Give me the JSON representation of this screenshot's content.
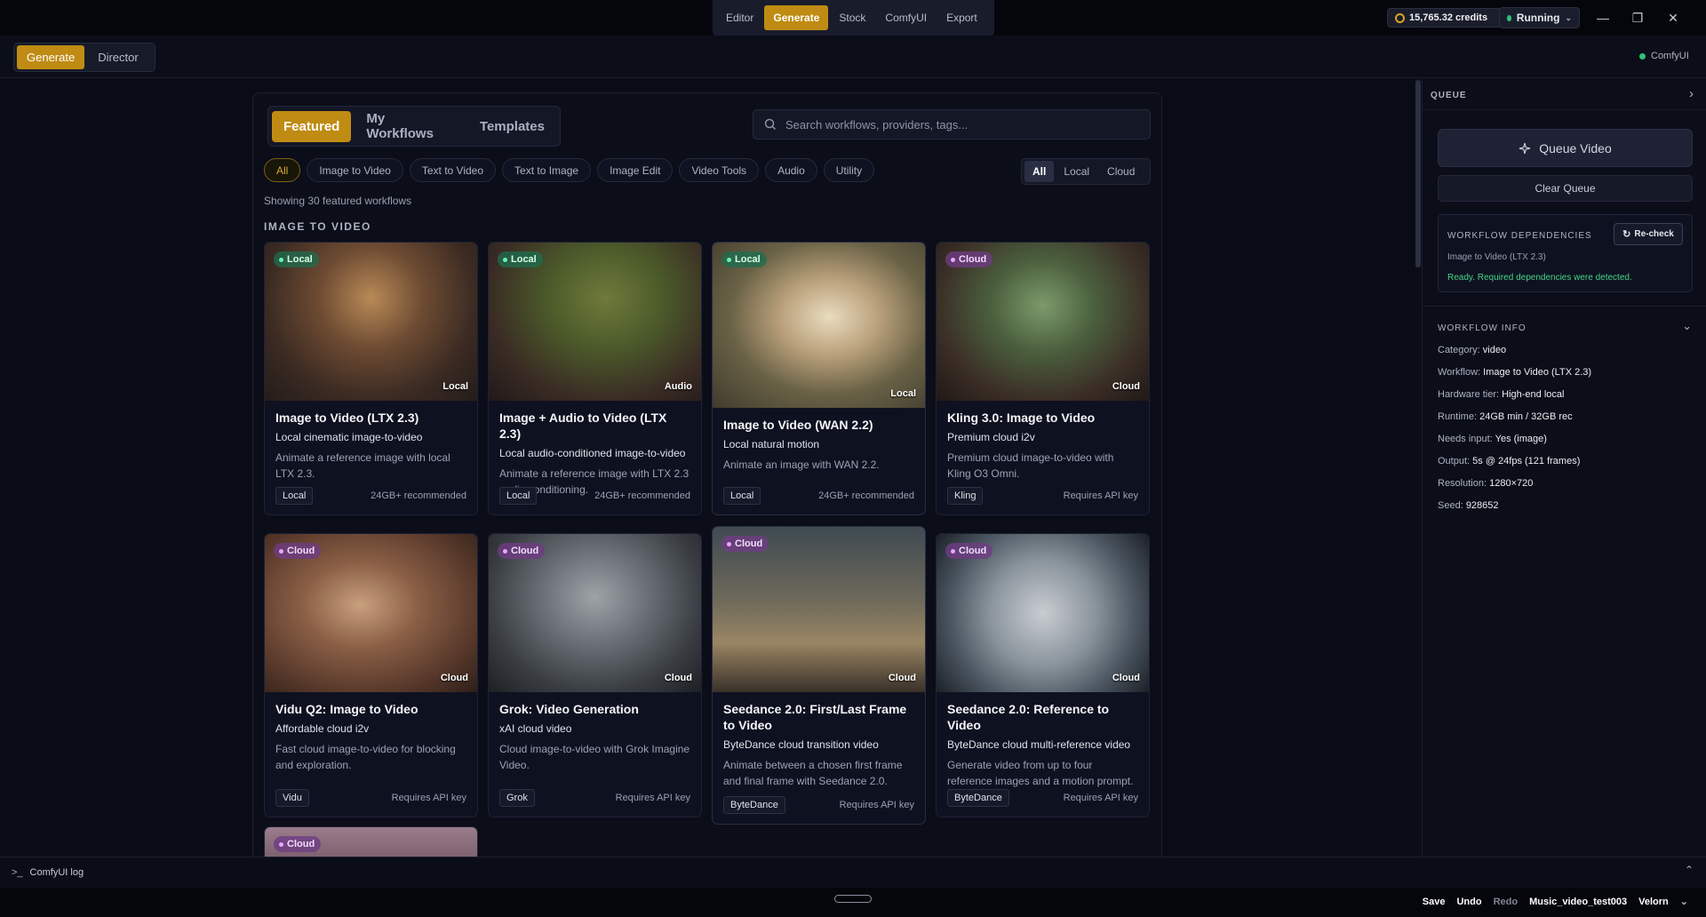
{
  "topnav": {
    "items": [
      "Editor",
      "Generate",
      "Stock",
      "ComfyUI",
      "Export"
    ],
    "active": 1
  },
  "status": {
    "credits": "15,765.32 credits",
    "running": "Running"
  },
  "mode": {
    "items": [
      "Generate",
      "Director"
    ]
  },
  "comfy_status": "ComfyUI",
  "tabs": [
    "Featured",
    "My Workflows",
    "Templates"
  ],
  "search_placeholder": "Search workflows, providers, tags...",
  "chips": [
    "All",
    "Image to Video",
    "Text to Video",
    "Text to Image",
    "Image Edit",
    "Video Tools",
    "Audio",
    "Utility"
  ],
  "location_filter": [
    "All",
    "Local",
    "Cloud"
  ],
  "showing": "Showing 30 featured workflows",
  "section_title": "IMAGE TO VIDEO",
  "cards": [
    {
      "badge": "Local",
      "corner": "Local",
      "title": "Image to Video (LTX 2.3)",
      "subtitle": "Local cinematic image-to-video",
      "desc": "Animate a reference image with local LTX 2.3.",
      "tag": "Local",
      "req": "24GB+ recommended"
    },
    {
      "badge": "Local",
      "corner": "Audio",
      "title": "Image + Audio to Video (LTX 2.3)",
      "subtitle": "Local audio-conditioned image-to-video",
      "desc": "Animate a reference image with LTX 2.3 audio conditioning.",
      "tag": "Local",
      "req": "24GB+ recommended"
    },
    {
      "badge": "Local",
      "corner": "Local",
      "title": "Image to Video (WAN 2.2)",
      "subtitle": "Local natural motion",
      "desc": "Animate an image with WAN 2.2.",
      "tag": "Local",
      "req": "24GB+ recommended"
    },
    {
      "badge": "Cloud",
      "corner": "Cloud",
      "title": "Kling 3.0: Image to Video",
      "subtitle": "Premium cloud i2v",
      "desc": "Premium cloud image-to-video with Kling O3 Omni.",
      "tag": "Kling",
      "req": "Requires API key"
    },
    {
      "badge": "Cloud",
      "corner": "Cloud",
      "title": "Vidu Q2: Image to Video",
      "subtitle": "Affordable cloud i2v",
      "desc": "Fast cloud image-to-video for blocking and exploration.",
      "tag": "Vidu",
      "req": "Requires API key"
    },
    {
      "badge": "Cloud",
      "corner": "Cloud",
      "title": "Grok: Video Generation",
      "subtitle": "xAI cloud video",
      "desc": "Cloud image-to-video with Grok Imagine Video.",
      "tag": "Grok",
      "req": "Requires API key"
    },
    {
      "badge": "Cloud",
      "corner": "Cloud",
      "title": "Seedance 2.0: First/Last Frame to Video",
      "subtitle": "ByteDance cloud transition video",
      "desc": "Animate between a chosen first frame and final frame with Seedance 2.0.",
      "tag": "ByteDance",
      "req": "Requires API key"
    },
    {
      "badge": "Cloud",
      "corner": "Cloud",
      "title": "Seedance 2.0: Reference to Video",
      "subtitle": "ByteDance cloud multi-reference video",
      "desc": "Generate video from up to four reference images and a motion prompt.",
      "tag": "ByteDance",
      "req": "Requires API key"
    },
    {
      "badge": "Cloud"
    }
  ],
  "queue": {
    "header": "QUEUE",
    "queue_btn": "Queue Video",
    "clear_btn": "Clear Queue",
    "deps_title": "WORKFLOW DEPENDENCIES",
    "recheck": "Re-check",
    "deps_workflow": "Image to Video (LTX 2.3)",
    "deps_ready": "Ready. Required dependencies were detected.",
    "info_title": "WORKFLOW INFO",
    "info": [
      {
        "k": "Category:",
        "v": "video"
      },
      {
        "k": "Workflow:",
        "v": "Image to Video (LTX 2.3)"
      },
      {
        "k": "Hardware tier:",
        "v": "High-end local"
      },
      {
        "k": "Runtime:",
        "v": "24GB min / 32GB rec"
      },
      {
        "k": "Needs input:",
        "v": "Yes (image)"
      },
      {
        "k": "Output:",
        "v": "5s @ 24fps (121 frames)"
      },
      {
        "k": "Resolution:",
        "v": "1280×720"
      },
      {
        "k": "Seed:",
        "v": "928652"
      }
    ]
  },
  "log_label": "ComfyUI log",
  "statusbar": {
    "save": "Save",
    "undo": "Undo",
    "redo": "Redo",
    "project": "Music_video_test003",
    "user": "Velorn"
  }
}
